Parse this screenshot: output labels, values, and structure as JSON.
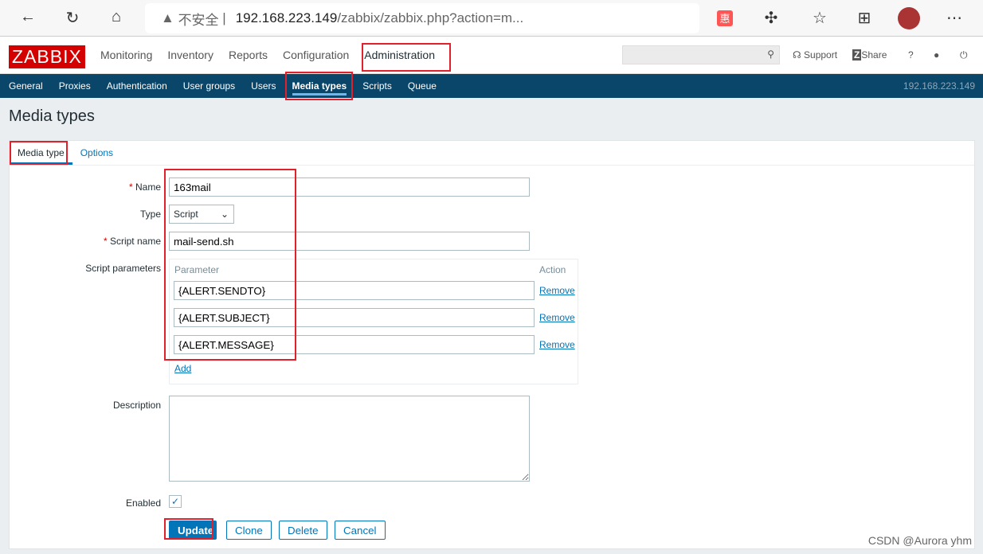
{
  "browser": {
    "security": "不安全",
    "url_host": "192.168.223.149",
    "url_path": "/zabbix/zabbix.php?action=m..."
  },
  "topnav": {
    "logo": "ZABBIX",
    "items": [
      "Monitoring",
      "Inventory",
      "Reports",
      "Configuration",
      "Administration"
    ],
    "support": "Support",
    "share": "Share",
    "help": "?"
  },
  "subnav": {
    "items": [
      "General",
      "Proxies",
      "Authentication",
      "User groups",
      "Users",
      "Media types",
      "Scripts",
      "Queue"
    ],
    "server": "192.168.223.149"
  },
  "page": {
    "title": "Media types"
  },
  "tabs": [
    "Media type",
    "Options"
  ],
  "form": {
    "name_label": "Name",
    "name_value": "163mail",
    "type_label": "Type",
    "type_value": "Script",
    "script_label": "Script name",
    "script_value": "mail-send.sh",
    "params_label": "Script parameters",
    "param_header": "Parameter",
    "action_header": "Action",
    "params": [
      "{ALERT.SENDTO}",
      "{ALERT.SUBJECT}",
      "{ALERT.MESSAGE}"
    ],
    "remove": "Remove",
    "add": "Add",
    "description_label": "Description",
    "description_value": "",
    "enabled_label": "Enabled",
    "enabled": true,
    "buttons": {
      "update": "Update",
      "clone": "Clone",
      "delete": "Delete",
      "cancel": "Cancel"
    }
  },
  "watermark": "CSDN @Aurora yhm"
}
